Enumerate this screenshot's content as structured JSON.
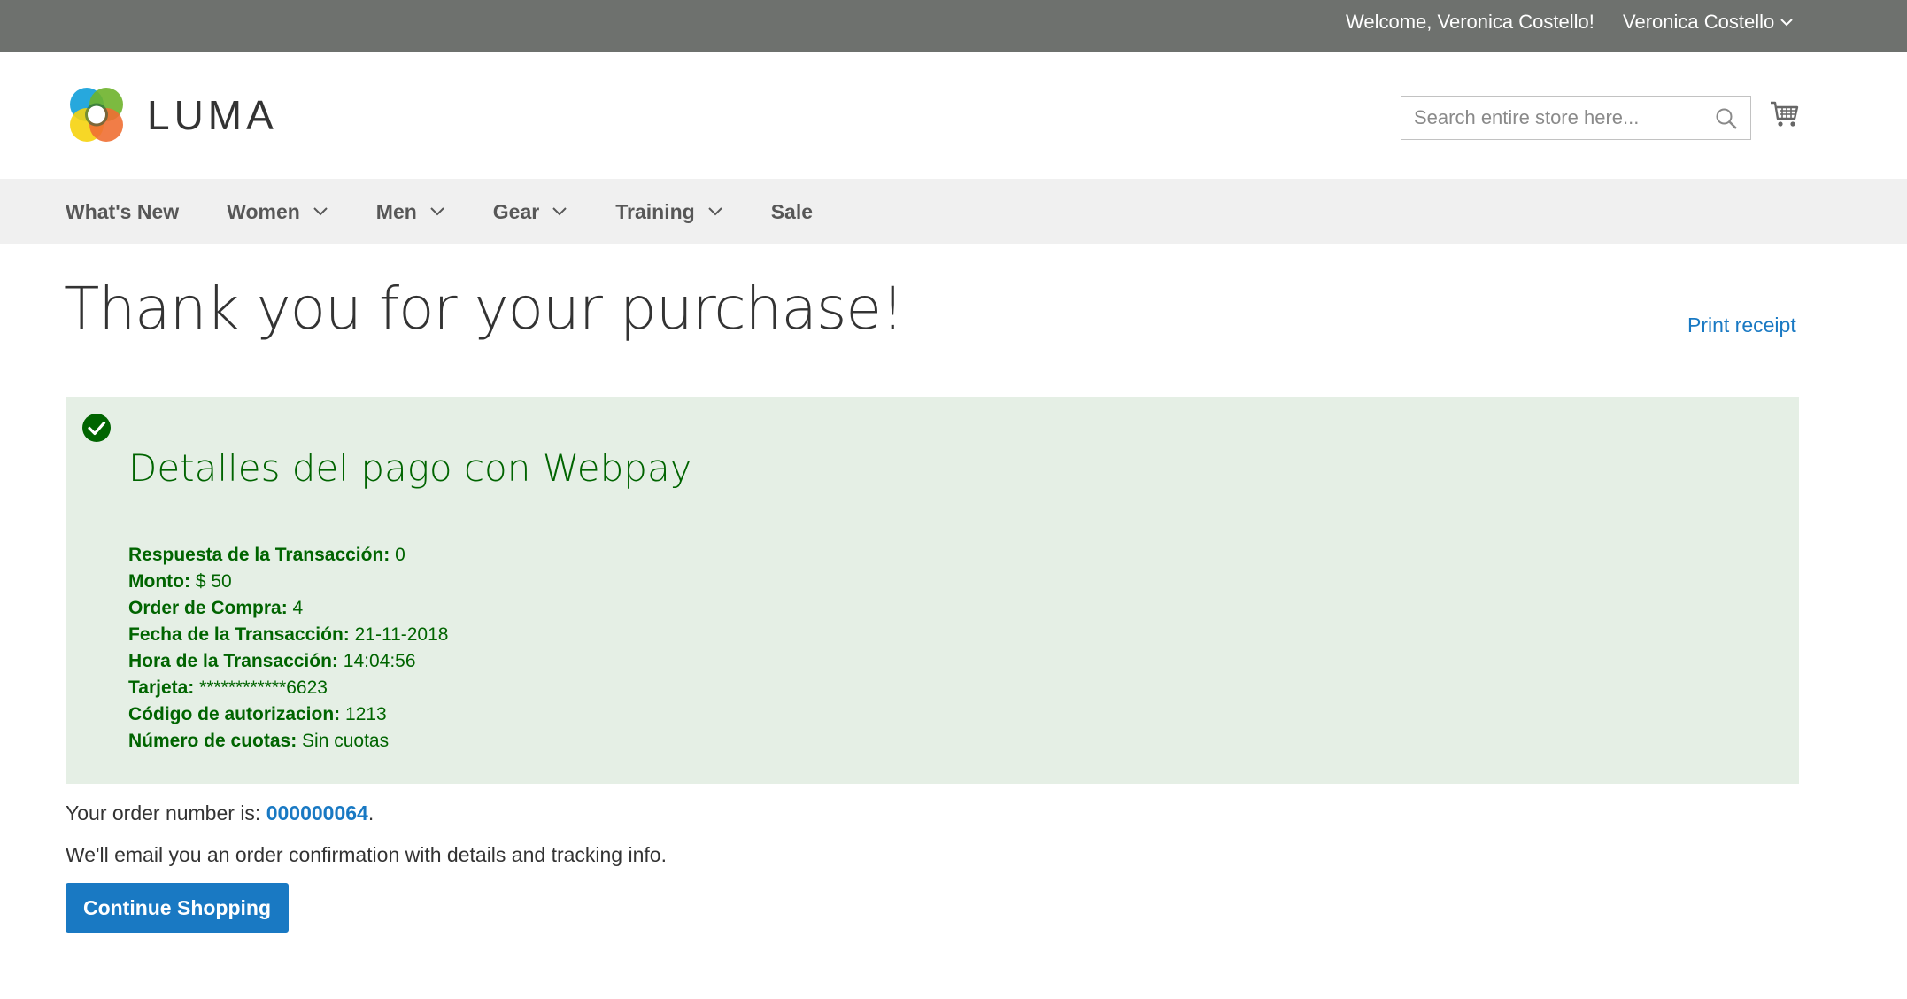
{
  "topbar": {
    "welcome": "Welcome, Veronica Costello!",
    "account_name": "Veronica Costello"
  },
  "header": {
    "logo_text": "LUMA",
    "search_placeholder": "Search entire store here...",
    "search_value": ""
  },
  "nav": {
    "items": [
      {
        "label": "What's New",
        "dropdown": false
      },
      {
        "label": "Women",
        "dropdown": true
      },
      {
        "label": "Men",
        "dropdown": true
      },
      {
        "label": "Gear",
        "dropdown": true
      },
      {
        "label": "Training",
        "dropdown": true
      },
      {
        "label": "Sale",
        "dropdown": false
      }
    ]
  },
  "main": {
    "title": "Thank you for your purchase!",
    "print_receipt": "Print receipt",
    "payment": {
      "title": "Detalles del pago con Webpay",
      "rows": [
        {
          "label": "Respuesta de la Transacción:",
          "value": "0"
        },
        {
          "label": "Monto:",
          "value": "$ 50"
        },
        {
          "label": "Order de Compra:",
          "value": "4"
        },
        {
          "label": "Fecha de la Transacción:",
          "value": "21-11-2018"
        },
        {
          "label": "Hora de la Transacción:",
          "value": "14:04:56"
        },
        {
          "label": "Tarjeta:",
          "value": "************6623"
        },
        {
          "label": "Código de autorizacion:",
          "value": "1213"
        },
        {
          "label": "Número de cuotas:",
          "value": "Sin cuotas"
        }
      ]
    },
    "order_prefix": "Your order number is: ",
    "order_number": "000000064",
    "order_suffix": ".",
    "email_note": "We'll email you an order confirmation with details and tracking info.",
    "continue_label": "Continue Shopping"
  },
  "colors": {
    "topbar_bg": "#6e716e",
    "nav_bg": "#f0f0f0",
    "success_bg": "#e5efe5",
    "success_text": "#006400",
    "link": "#1979c3",
    "button": "#1979c3"
  }
}
